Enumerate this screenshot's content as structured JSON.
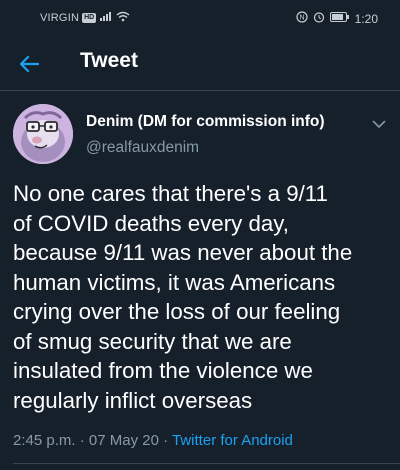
{
  "status_bar": {
    "carrier": "VIRGIN",
    "hd_badge": "HD",
    "time": "1:20"
  },
  "header": {
    "title": "Tweet",
    "back_icon": "arrow-left-icon"
  },
  "tweet": {
    "author_name": "Denim (DM for commission info)",
    "author_handle": "@realfauxdenim",
    "text_lines": [
      "No one cares that there's a 9/11",
      "of COVID deaths every day,",
      "because 9/11 was never about the",
      "human victims, it was Americans",
      "crying over the loss of our feeling",
      "of smug security that we are",
      "insulated from the violence we",
      "regularly inflict overseas"
    ],
    "time": "2:45 p.m.",
    "date": "07 May 20",
    "separator": "·",
    "source": "Twitter for Android"
  },
  "colors": {
    "background": "#15202b",
    "text": "#ffffff",
    "secondary": "#8899a6",
    "accent": "#1da1f2",
    "divider": "#38444d"
  }
}
